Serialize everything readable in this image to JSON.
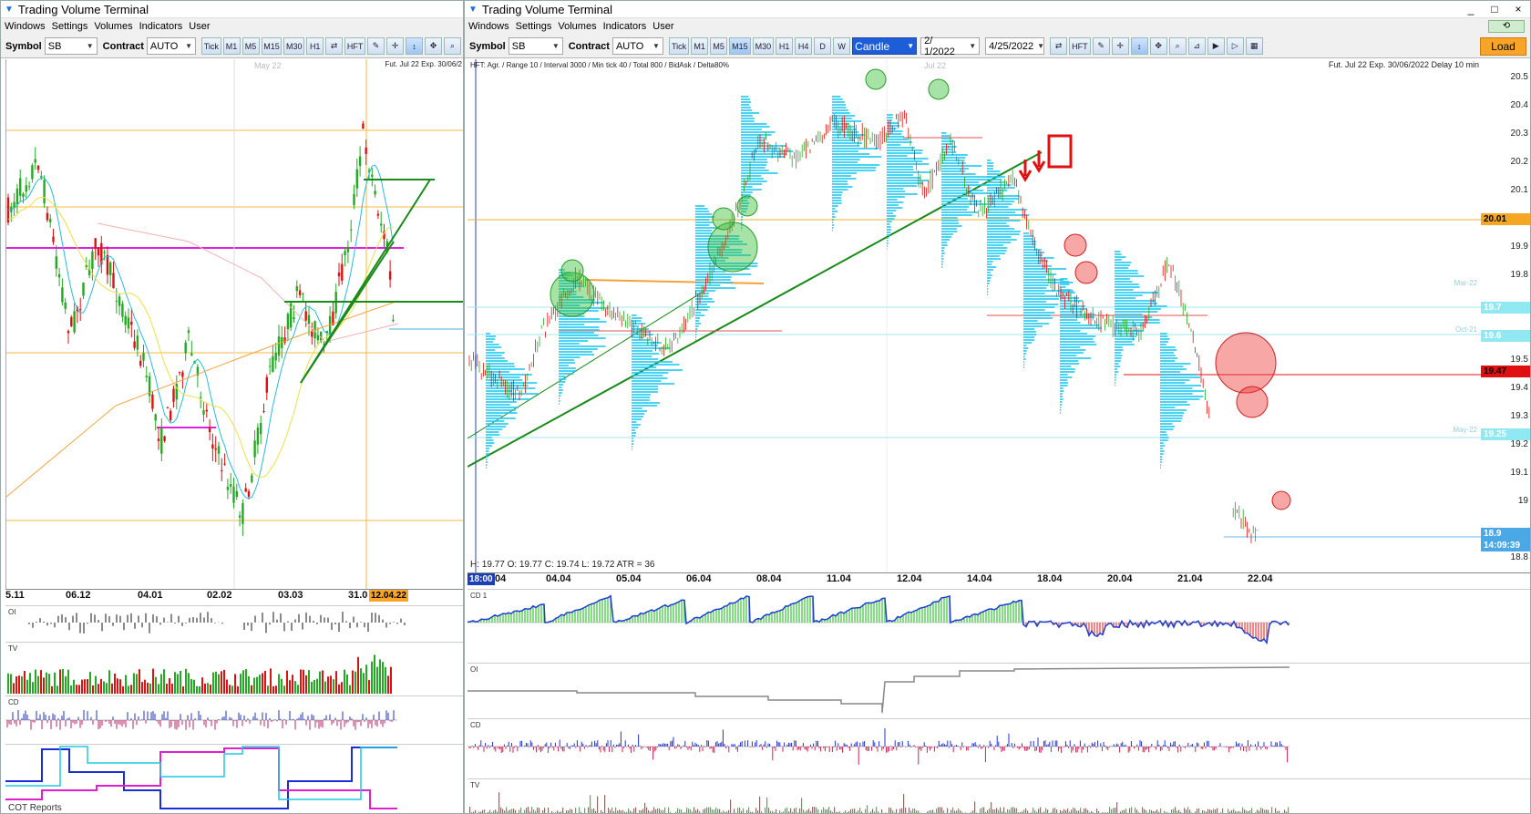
{
  "left_window": {
    "title": "Trading Volume Terminal",
    "menu": [
      "Windows",
      "Settings",
      "Volumes",
      "Indicators",
      "User"
    ],
    "toolbar": {
      "symbol_label": "Symbol",
      "symbol_value": "SB",
      "contract_label": "Contract",
      "contract_value": "AUTO",
      "buttons": [
        "Tick",
        "M1",
        "M5",
        "M15",
        "M30",
        "H1"
      ],
      "hft_label": "HFT"
    },
    "chart_header": "Fut. Jul 22 Exp. 30/06/2",
    "month_label": "May 22",
    "date_axis": [
      "5.11",
      "06.12",
      "04.01",
      "02.02",
      "03.03",
      "31.0"
    ],
    "cursor_date": "12.04.22",
    "panels": {
      "oi": "OI",
      "tv": "TV",
      "cd": "CD",
      "cot": "COT Reports"
    }
  },
  "right_window": {
    "title": "Trading Volume Terminal",
    "menu": [
      "Windows",
      "Settings",
      "Volumes",
      "Indicators",
      "User"
    ],
    "window_controls": [
      "_",
      "□",
      "×"
    ],
    "toolbar": {
      "symbol_label": "Symbol",
      "symbol_value": "SB",
      "contract_label": "Contract",
      "contract_value": "AUTO",
      "buttons": [
        "Tick",
        "M1",
        "M5",
        "M15",
        "M30",
        "H1",
        "H4",
        "D",
        "W"
      ],
      "chart_type": "Candle",
      "date_from": "2/ 1/2022",
      "date_to": "4/25/2022",
      "hft_label": "HFT",
      "load_label": "Load"
    },
    "chart_header_left": "HFT: Agr. / Range 10 / Interval 3000 / Min tick 40 / Total 800 / BidAsk / Delta80%",
    "chart_header_right": "Fut. Jul 22 Exp. 30/06/2022 Delay 10 min",
    "month_label": "Jul 22",
    "ohlc_line": "H: 19.77  O: 19.77  C: 19.74  L: 19.72  ATR = 36",
    "time_tab": "18:00",
    "date_axis": [
      "04",
      "04.04",
      "05.04",
      "06.04",
      "08.04",
      "11.04",
      "12.04",
      "14.04",
      "18.04",
      "20.04",
      "21.04",
      "22.04"
    ],
    "price_axis": [
      "20.5",
      "20.4",
      "20.3",
      "20.2",
      "20.1",
      "19.9",
      "19.8",
      "19.5",
      "19.4",
      "19.3",
      "19.2",
      "19.1",
      "19",
      "18.8"
    ],
    "price_tags": {
      "level_2001": "20.01",
      "level_197": "19.7",
      "level_196": "19.6",
      "level_1947": "19.47",
      "level_1925": "19.25",
      "last_price": "18.9",
      "last_time": "14:09:39"
    },
    "contract_tags": {
      "mar": "Mar-22",
      "oct": "Oct-21",
      "may": "May-22"
    },
    "panels": {
      "cd1": "CD 1",
      "oi": "OI",
      "cd": "CD",
      "tv": "TV"
    },
    "colors": {
      "bull": "#22aa22",
      "bear": "#dd1111",
      "profile": "#1ec8f0",
      "trend": "#1a8a1a"
    }
  }
}
